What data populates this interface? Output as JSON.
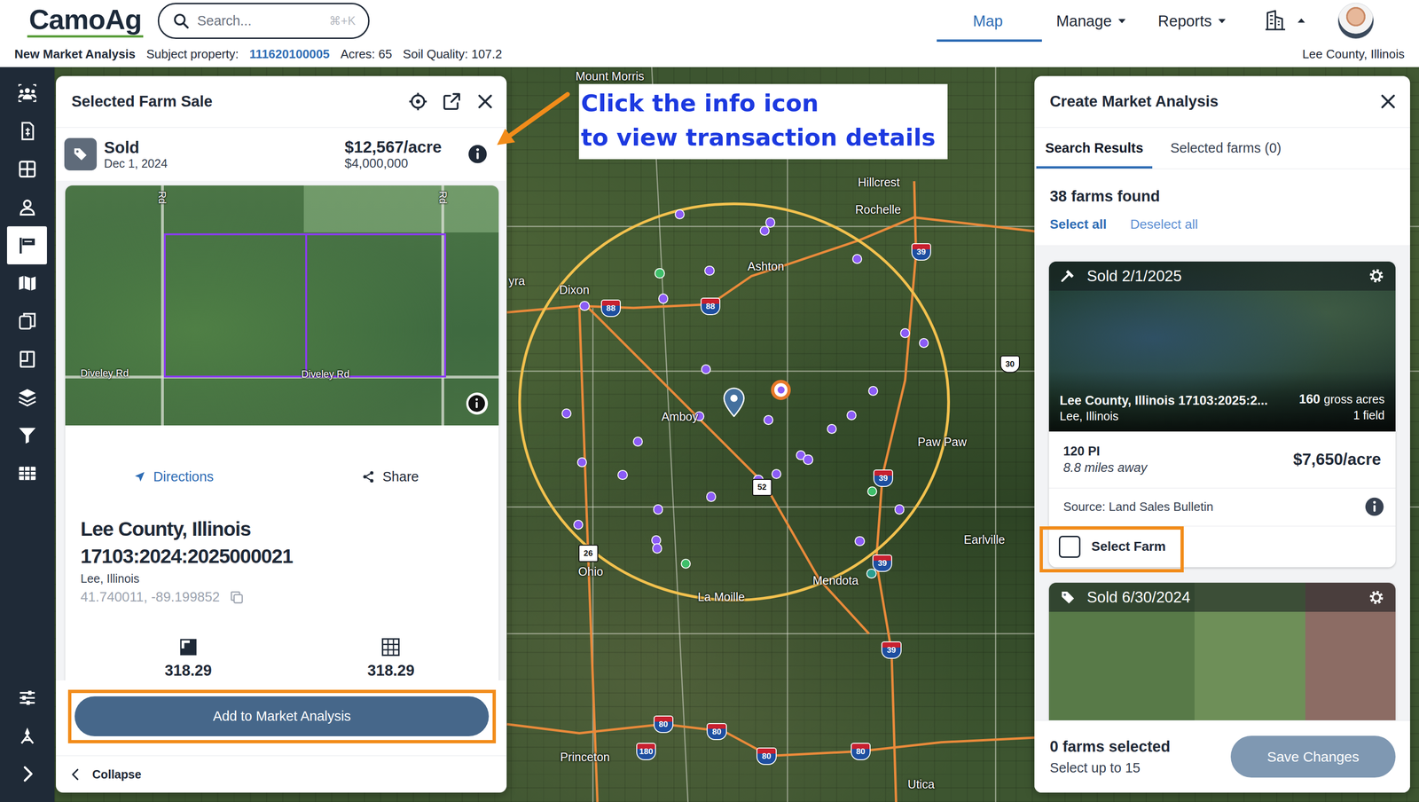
{
  "header": {
    "logo": "CamoAg",
    "search": {
      "placeholder": "Search...",
      "shortcut": "⌘+K"
    },
    "nav": [
      {
        "label": "Map",
        "selected": true,
        "dropdown": false
      },
      {
        "label": "Manage",
        "selected": false,
        "dropdown": true
      },
      {
        "label": "Reports",
        "selected": false,
        "dropdown": true
      }
    ]
  },
  "subheader": {
    "title": "New Market Analysis",
    "subject_label": "Subject property:",
    "subject_id": "111620100005",
    "acres": "Acres: 65",
    "soil_quality": "Soil Quality: 107.2",
    "region": "Lee County, Illinois"
  },
  "sidebar": {
    "items": [
      {
        "selected": false
      },
      {
        "selected": false
      },
      {
        "selected": false
      },
      {
        "selected": false
      },
      {
        "selected": true
      },
      {
        "selected": false
      },
      {
        "selected": false
      },
      {
        "selected": false
      },
      {
        "selected": false
      },
      {
        "selected": false
      },
      {
        "selected": false
      },
      {
        "selected": false
      },
      {
        "selected": false
      },
      {
        "selected": false
      }
    ]
  },
  "annotation": {
    "lines": [
      "Click the info icon",
      "to view transaction details"
    ]
  },
  "map": {
    "labels": [
      {
        "text": "Mount Morris"
      },
      {
        "text": "yra"
      },
      {
        "text": "Dixon"
      },
      {
        "text": "Ashton"
      },
      {
        "text": "Hillcrest"
      },
      {
        "text": "Rochelle"
      },
      {
        "text": "Amboy"
      },
      {
        "text": "Paw Paw"
      },
      {
        "text": "Earlville"
      },
      {
        "text": "Ohio"
      },
      {
        "text": "La Moille"
      },
      {
        "text": "Mendota"
      },
      {
        "text": "Princeton"
      },
      {
        "text": "Utica"
      }
    ],
    "shields": [
      {
        "number": "88",
        "kind": "interstate"
      },
      {
        "number": "88",
        "kind": "interstate"
      },
      {
        "number": "39",
        "kind": "interstate"
      },
      {
        "number": "30",
        "kind": "us"
      },
      {
        "number": "52",
        "kind": "state"
      },
      {
        "number": "39",
        "kind": "interstate"
      },
      {
        "number": "26",
        "kind": "state"
      },
      {
        "number": "39",
        "kind": "interstate"
      },
      {
        "number": "39",
        "kind": "interstate"
      },
      {
        "number": "80",
        "kind": "interstate"
      },
      {
        "number": "80",
        "kind": "interstate"
      },
      {
        "number": "180",
        "kind": "interstate"
      },
      {
        "number": "80",
        "kind": "interstate"
      },
      {
        "number": "80",
        "kind": "interstate"
      }
    ],
    "markers": [
      {
        "color": "#8b5cf6",
        "selected": false
      },
      {
        "color": "#8b5cf6",
        "selected": false
      },
      {
        "color": "#8b5cf6",
        "selected": false
      },
      {
        "color": "#3fbf6a",
        "selected": false
      },
      {
        "color": "#8b5cf6",
        "selected": false
      },
      {
        "color": "#8b5cf6",
        "selected": false
      },
      {
        "color": "#8b5cf6",
        "selected": false
      },
      {
        "color": "#8b5cf6",
        "selected": false
      },
      {
        "color": "#8b5cf6",
        "selected": false
      },
      {
        "color": "#8b5cf6",
        "selected": false
      },
      {
        "color": "#8b5cf6",
        "selected": false
      },
      {
        "color": "#8b5cf6",
        "selected": false
      },
      {
        "color": "#8b5cf6",
        "selected": false
      },
      {
        "color": "#8b5cf6",
        "selected": true
      },
      {
        "color": "#8b5cf6",
        "selected": false
      },
      {
        "color": "#8b5cf6",
        "selected": false
      },
      {
        "color": "#8b5cf6",
        "selected": false
      },
      {
        "color": "#8b5cf6",
        "selected": false
      },
      {
        "color": "#8b5cf6",
        "selected": false
      },
      {
        "color": "#8b5cf6",
        "selected": false
      },
      {
        "color": "#8b5cf6",
        "selected": false
      },
      {
        "color": "#8b5cf6",
        "selected": false
      },
      {
        "color": "#8b5cf6",
        "selected": false
      },
      {
        "color": "#8b5cf6",
        "selected": false
      },
      {
        "color": "#8b5cf6",
        "selected": false
      },
      {
        "color": "#8b5cf6",
        "selected": false
      },
      {
        "color": "#3fbf6a",
        "selected": false
      },
      {
        "color": "#8b5cf6",
        "selected": false
      },
      {
        "color": "#8b5cf6",
        "selected": false
      },
      {
        "color": "#8b5cf6",
        "selected": false
      },
      {
        "color": "#8b5cf6",
        "selected": false
      },
      {
        "color": "#8b5cf6",
        "selected": false
      },
      {
        "color": "#8b5cf6",
        "selected": false
      },
      {
        "color": "#8b5cf6",
        "selected": false
      },
      {
        "color": "#3fbf6a",
        "selected": false
      },
      {
        "color": "#2a9d8f",
        "selected": false
      }
    ]
  },
  "farm_panel": {
    "title": "Selected Farm Sale",
    "status": "Sold",
    "date": "Dec 1, 2024",
    "price_per_acre": "$12,567/acre",
    "price": "$4,000,000",
    "image_labels": [
      {
        "text": "Rd"
      },
      {
        "text": "Rd"
      },
      {
        "text": "Diveley Rd"
      },
      {
        "text": "Diveley Rd"
      }
    ],
    "actions": [
      {
        "label": "Directions"
      },
      {
        "label": "Share"
      }
    ],
    "name_lines": [
      "Lee County, Illinois",
      "17103:2024:2025000021"
    ],
    "location": "Lee, Illinois",
    "coordinates": "41.740011, -89.199852",
    "stats": [
      {
        "value": "318.29"
      },
      {
        "value": "318.29"
      }
    ],
    "add_button": "Add to Market Analysis",
    "collapse": "Collapse"
  },
  "market_panel": {
    "title": "Create Market Analysis",
    "tabs": [
      {
        "label": "Search Results",
        "selected": true
      },
      {
        "label": "Selected farms (0)",
        "selected": false
      }
    ],
    "count": "38 farms found",
    "select_all": "Select all",
    "deselect_all": "Deselect all",
    "cards": [
      {
        "kind": "auction",
        "status": "Sold 2/1/2025",
        "name": "Lee County, Illinois 17103:2025:2...",
        "location": "Lee, Illinois",
        "acres": "160",
        "acres_label": "gross acres",
        "fields": "1 field",
        "pi": "120 PI",
        "distance": "8.8 miles away",
        "price": "$7,650/acre",
        "source": "Source: Land Sales Bulletin",
        "select_label": "Select Farm",
        "checked": false
      },
      {
        "kind": "sale",
        "status": "Sold 6/30/2024"
      }
    ],
    "footer": {
      "selected_count": "0 farms selected",
      "limit": "Select up to 15",
      "save": {
        "label": "Save Changes",
        "disabled": true
      }
    }
  }
}
